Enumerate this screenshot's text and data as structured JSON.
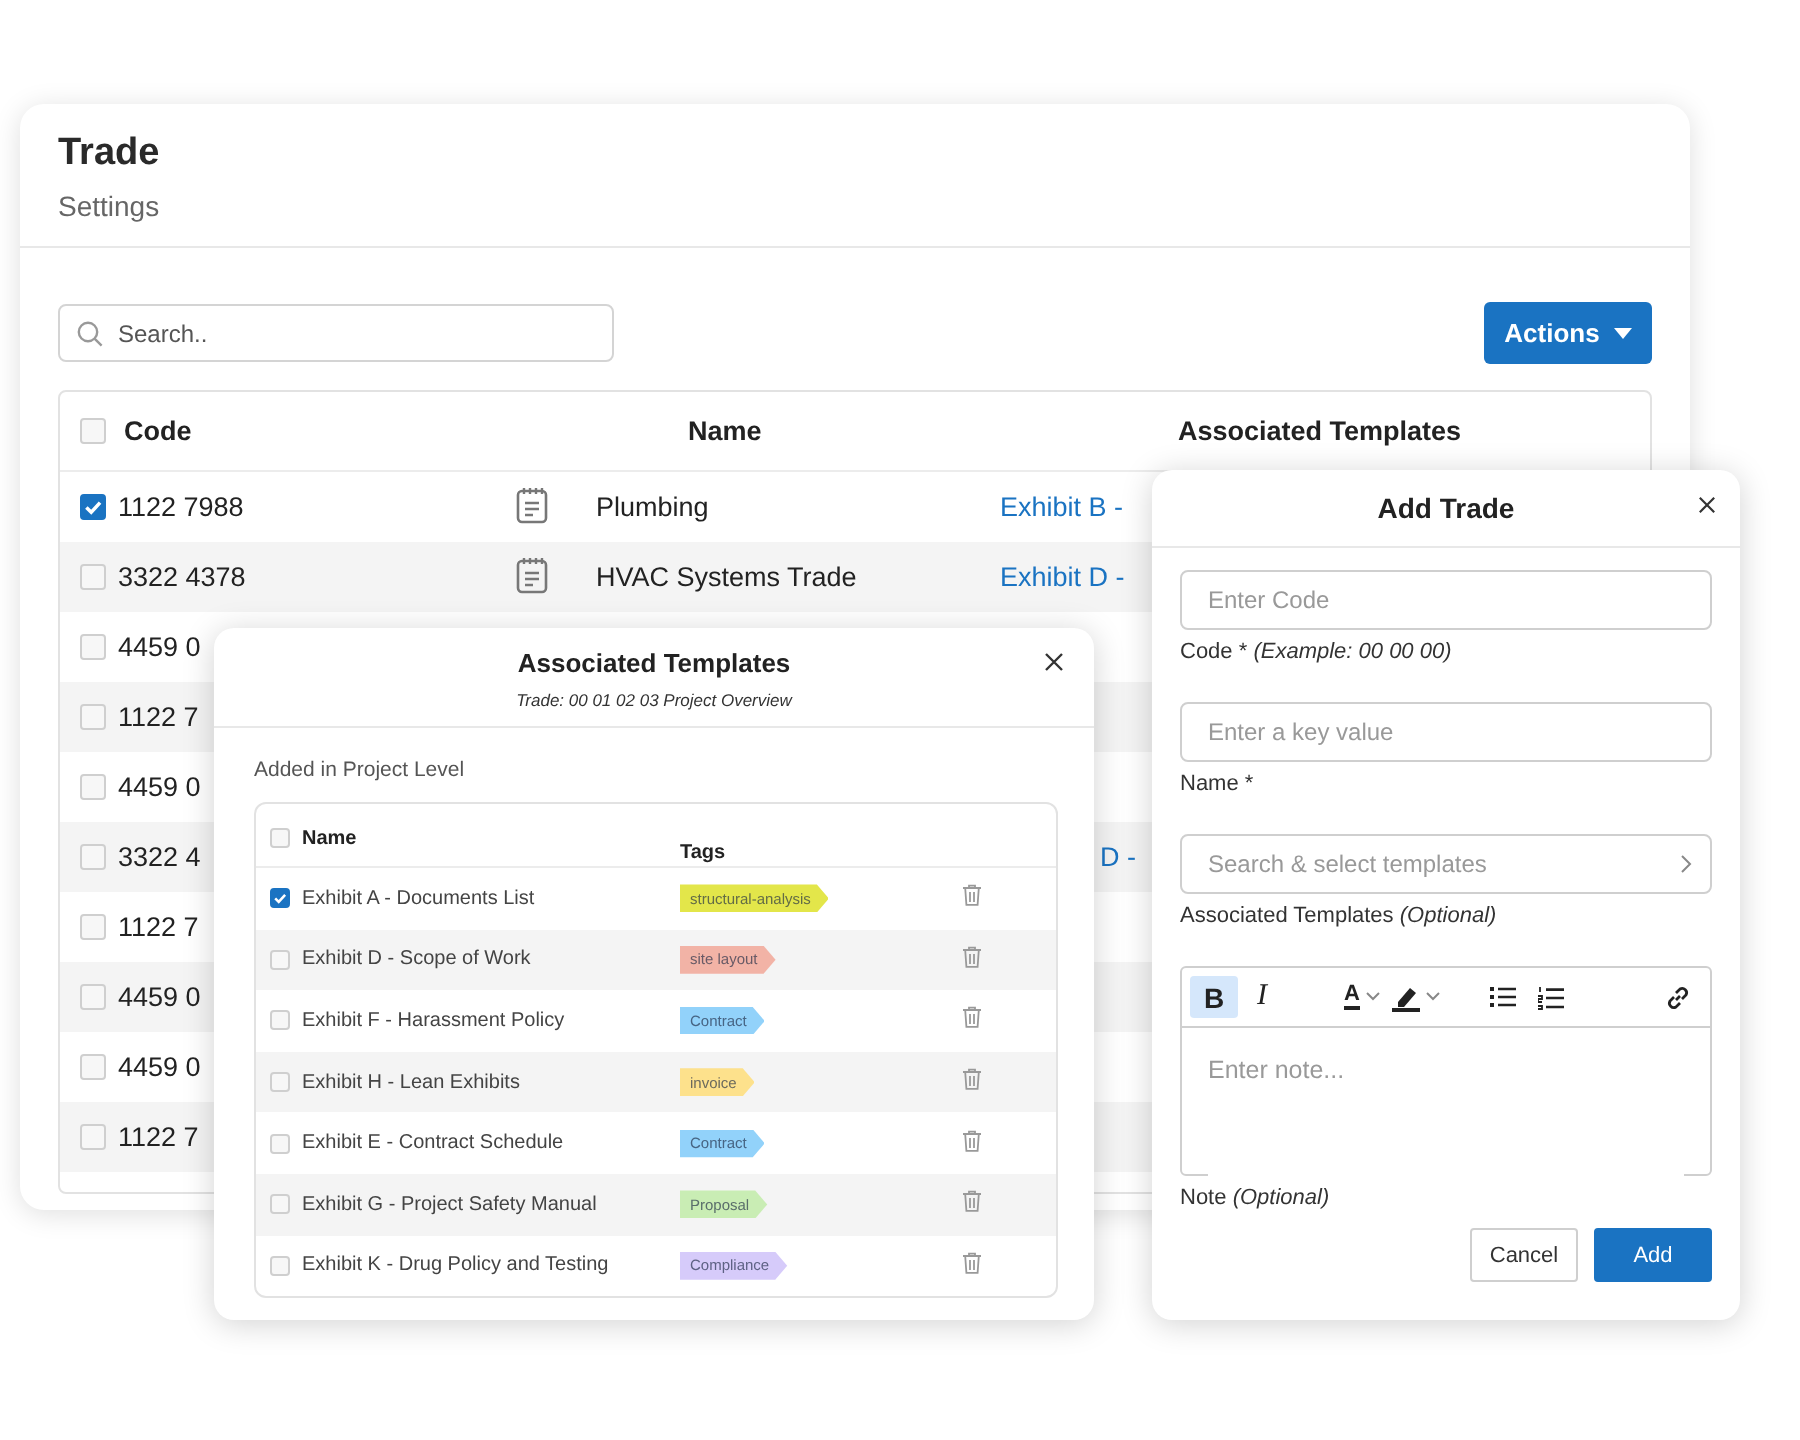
{
  "main": {
    "title": "Trade",
    "subtitle": "Settings",
    "search": {
      "placeholder": "Search.."
    },
    "actions_button": "Actions",
    "table": {
      "columns": [
        "Code",
        "Name",
        "Associated Templates"
      ],
      "header_checked": false,
      "rows": [
        {
          "code": "1122 7988",
          "checked": true,
          "note_icon": true,
          "name": "Plumbing",
          "template": "Exhibit B -"
        },
        {
          "code": "3322 4378",
          "checked": false,
          "note_icon": true,
          "name": "HVAC Systems Trade",
          "template": "Exhibit D -"
        },
        {
          "code": "4459 0",
          "checked": false
        },
        {
          "code": "1122 7",
          "checked": false
        },
        {
          "code": "4459 0",
          "checked": false
        },
        {
          "code": "3322 4",
          "checked": false,
          "template": "D -",
          "partial": true
        },
        {
          "code": "1122 7",
          "checked": false
        },
        {
          "code": "4459 0",
          "checked": false
        },
        {
          "code": "4459 0",
          "checked": false
        },
        {
          "code": "1122 7",
          "checked": false
        }
      ]
    }
  },
  "templates_dialog": {
    "title": "Associated Templates",
    "subtitle": "Trade: 00 01 02 03 Project Overview",
    "section": "Added in Project Level",
    "columns": [
      "Name",
      "Tags"
    ],
    "header_checked": false,
    "rows": [
      {
        "name": "Exhibit A - Documents List",
        "checked": true,
        "tag": "structural-analysis",
        "color": "#e3e64a"
      },
      {
        "name": "Exhibit D - Scope of Work",
        "checked": false,
        "tag": "site layout",
        "color": "#f2b3a6"
      },
      {
        "name": "Exhibit F - Harassment Policy",
        "checked": false,
        "tag": "Contract",
        "color": "#92d2fa"
      },
      {
        "name": "Exhibit H - Lean Exhibits",
        "checked": false,
        "tag": "invoice",
        "color": "#fde18c"
      },
      {
        "name": "Exhibit E - Contract Schedule",
        "checked": false,
        "tag": "Contract",
        "color": "#92d2fa"
      },
      {
        "name": "Exhibit G - Project Safety Manual",
        "checked": false,
        "tag": "Proposal",
        "color": "#c9edb4"
      },
      {
        "name": "Exhibit K - Drug Policy and Testing",
        "checked": false,
        "tag": "Compliance",
        "color": "#d6cbfa"
      }
    ]
  },
  "add_trade_dialog": {
    "title": "Add Trade",
    "fields": [
      {
        "kind": "text",
        "placeholder": "Enter Code",
        "label": "Code *",
        "hint": "(Example: 00 00 00)"
      },
      {
        "kind": "text",
        "placeholder": "Enter a key value",
        "label": "Name *"
      },
      {
        "kind": "select",
        "placeholder": "Search & select templates",
        "label": "Associated Templates",
        "hint": "(Optional)"
      }
    ],
    "editor": {
      "toolbar": [
        {
          "kind": "bold",
          "label": "B",
          "selected": true
        },
        {
          "kind": "italic",
          "label": "I",
          "selected": false
        },
        {
          "kind": "text-color",
          "label": "A",
          "selected": false
        },
        {
          "kind": "highlight",
          "selected": false
        },
        {
          "kind": "bullet-list",
          "selected": false
        },
        {
          "kind": "numbered-list",
          "selected": false
        },
        {
          "kind": "link",
          "selected": false
        }
      ],
      "placeholder": "Enter note...",
      "label": "Note",
      "hint": "(Optional)"
    },
    "buttons": [
      {
        "kind": "secondary",
        "label": "Cancel"
      },
      {
        "kind": "primary",
        "label": "Add"
      }
    ]
  }
}
